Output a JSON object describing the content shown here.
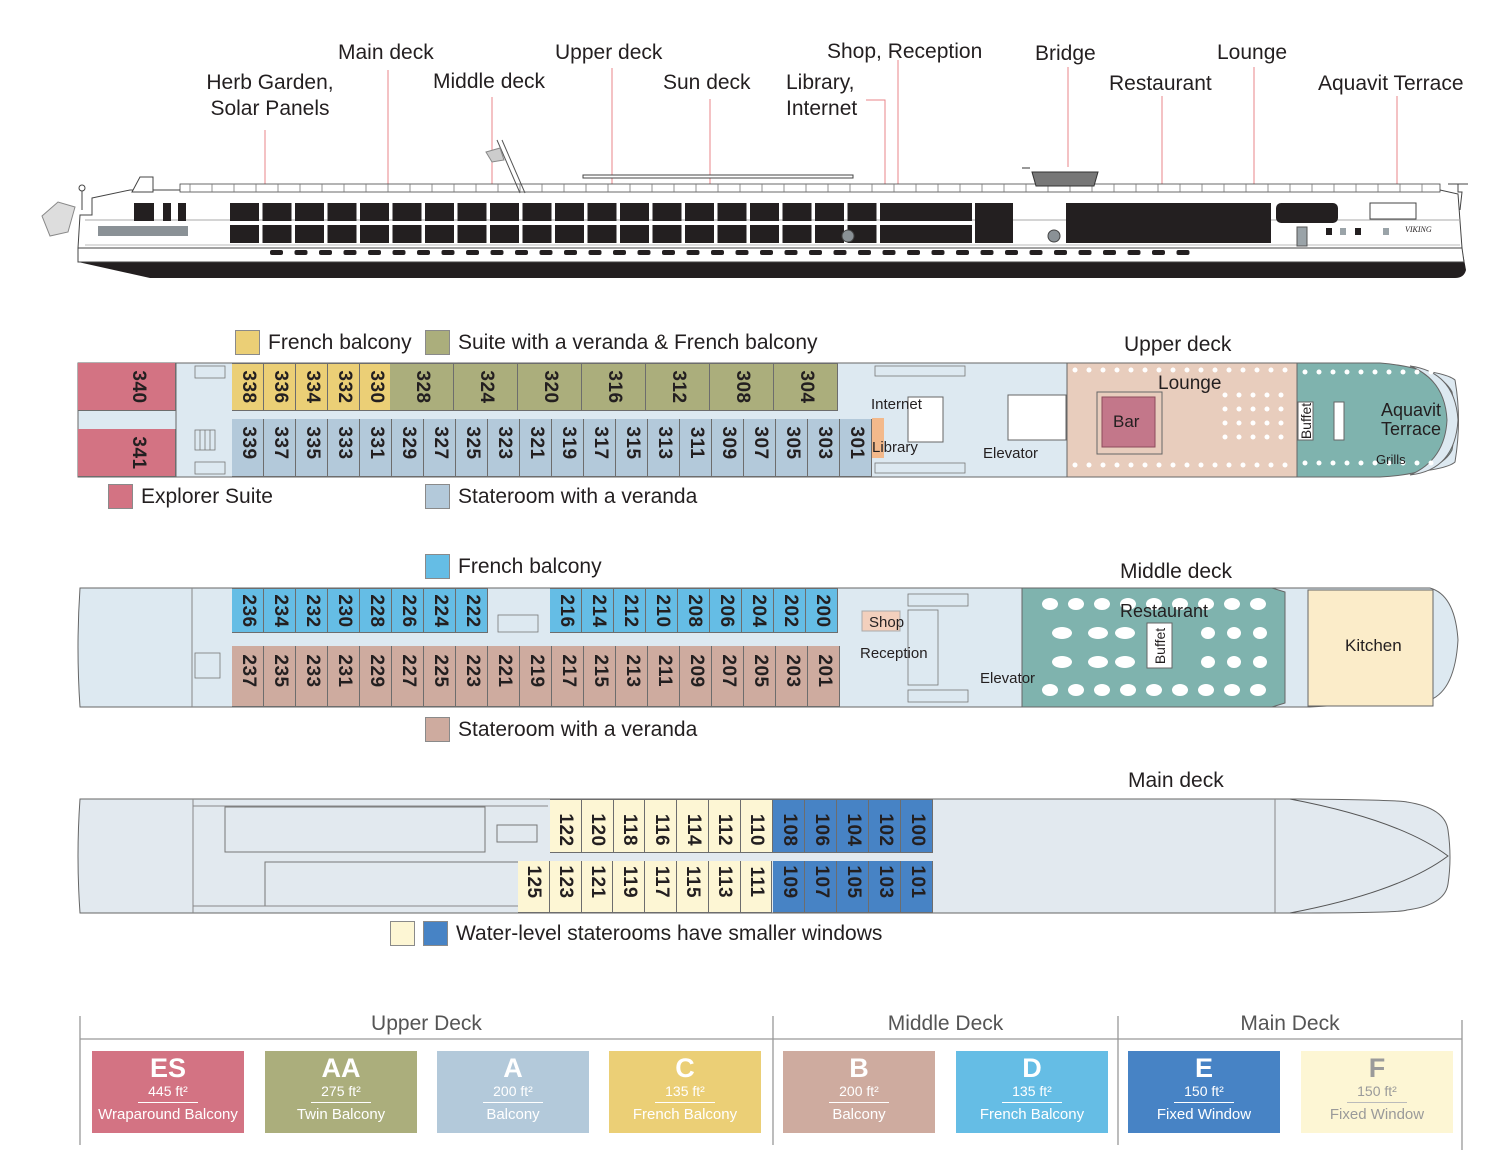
{
  "profile": {
    "callouts": [
      {
        "id": "herb-garden",
        "lines": [
          "Herb Garden,",
          "Solar Panels"
        ]
      },
      {
        "id": "main-deck",
        "lines": [
          "Main deck"
        ]
      },
      {
        "id": "middle-deck",
        "lines": [
          "Middle deck"
        ]
      },
      {
        "id": "upper-deck",
        "lines": [
          "Upper deck"
        ]
      },
      {
        "id": "sun-deck",
        "lines": [
          "Sun deck"
        ]
      },
      {
        "id": "library-internet",
        "lines": [
          "Library,",
          "Internet"
        ]
      },
      {
        "id": "shop-reception",
        "lines": [
          "Shop, Reception"
        ]
      },
      {
        "id": "bridge",
        "lines": [
          "Bridge"
        ]
      },
      {
        "id": "restaurant",
        "lines": [
          "Restaurant"
        ]
      },
      {
        "id": "lounge",
        "lines": [
          "Lounge"
        ]
      },
      {
        "id": "aquavit-terrace",
        "lines": [
          "Aquavit Terrace"
        ]
      }
    ],
    "ship_name": "VIKING"
  },
  "upper_deck": {
    "title": "Upper deck",
    "legend": {
      "french_balcony": "French balcony",
      "suite": "Suite with a veranda & French balcony",
      "explorer": "Explorer Suite",
      "veranda": "Stateroom with a veranda"
    },
    "explorer_cabins": [
      "340",
      "341"
    ],
    "top_french": [
      "338",
      "336",
      "334",
      "332",
      "330"
    ],
    "top_suites": [
      "328",
      "324",
      "320",
      "316",
      "312",
      "308",
      "304"
    ],
    "bottom_veranda": [
      "339",
      "337",
      "335",
      "333",
      "331",
      "329",
      "327",
      "325",
      "323",
      "321",
      "319",
      "317",
      "315",
      "313",
      "311",
      "309",
      "307",
      "305",
      "303",
      "301"
    ],
    "rooms": {
      "internet": "Internet",
      "library": "Library",
      "elevator": "Elevator",
      "lounge": "Lounge",
      "bar": "Bar",
      "buffet": "Buffet",
      "aquavit": "Aquavit",
      "terrace": "Terrace",
      "grills": "Grills"
    }
  },
  "middle_deck": {
    "title": "Middle deck",
    "legend": {
      "french_balcony": "French balcony",
      "veranda": "Stateroom with a veranda"
    },
    "top_french_a": [
      "236",
      "234",
      "232",
      "230",
      "228",
      "226",
      "224",
      "222"
    ],
    "top_french_b": [
      "216",
      "214",
      "212",
      "210",
      "208",
      "206",
      "204",
      "202",
      "200"
    ],
    "bottom_veranda": [
      "237",
      "235",
      "233",
      "231",
      "229",
      "227",
      "225",
      "223",
      "221",
      "219",
      "217",
      "215",
      "213",
      "211",
      "209",
      "207",
      "205",
      "203",
      "201"
    ],
    "rooms": {
      "shop": "Shop",
      "reception": "Reception",
      "elevator": "Elevator",
      "restaurant": "Restaurant",
      "buffet": "Buffet",
      "kitchen": "Kitchen"
    }
  },
  "main_deck": {
    "title": "Main deck",
    "top_f": [
      "122",
      "120",
      "118",
      "116",
      "114",
      "112",
      "110"
    ],
    "top_e": [
      "108",
      "106",
      "104",
      "102",
      "100"
    ],
    "bottom_f": [
      "125",
      "123",
      "121",
      "119",
      "117",
      "115",
      "113",
      "111"
    ],
    "bottom_e": [
      "109",
      "107",
      "105",
      "103",
      "101"
    ],
    "legend": "Water-level staterooms have smaller windows"
  },
  "categories": {
    "groups": [
      {
        "title": "Upper Deck",
        "cards": [
          {
            "code": "ES",
            "size": "445 ft²",
            "desc": "Wraparound Balcony",
            "color": "#d37383"
          },
          {
            "code": "AA",
            "size": "275 ft²",
            "desc": "Twin Balcony",
            "color": "#abae7c"
          },
          {
            "code": "A",
            "size": "200 ft²",
            "desc": "Balcony",
            "color": "#b3c9da"
          },
          {
            "code": "C",
            "size": "135 ft²",
            "desc": "French Balcony",
            "color": "#ebcf76"
          }
        ]
      },
      {
        "title": "Middle Deck",
        "cards": [
          {
            "code": "B",
            "size": "200 ft²",
            "desc": "Balcony",
            "color": "#ceab9f"
          },
          {
            "code": "D",
            "size": "135 ft²",
            "desc": "French Balcony",
            "color": "#65bde5"
          }
        ]
      },
      {
        "title": "Main Deck",
        "cards": [
          {
            "code": "E",
            "size": "150 ft²",
            "desc": "Fixed Window",
            "color": "#4783c5"
          },
          {
            "code": "F",
            "size": "150 ft²",
            "desc": "Fixed Window",
            "color": "#fdf6d4"
          }
        ]
      }
    ]
  },
  "colors": {
    "explorer": "#d37383",
    "suite": "#abae7c",
    "veranda_upper": "#b3c9da",
    "french_upper": "#ebcf76",
    "veranda_middle": "#ceab9f",
    "french_middle": "#65bde5",
    "water_e": "#4783c5",
    "water_f": "#fdf6d4",
    "corridor": "#dde9f1",
    "lounge": "#e8cdbd",
    "terrace": "#7fb3ae",
    "library": "#f3b98b",
    "kitchen": "#fbecc9",
    "bar": "#c3778a"
  }
}
